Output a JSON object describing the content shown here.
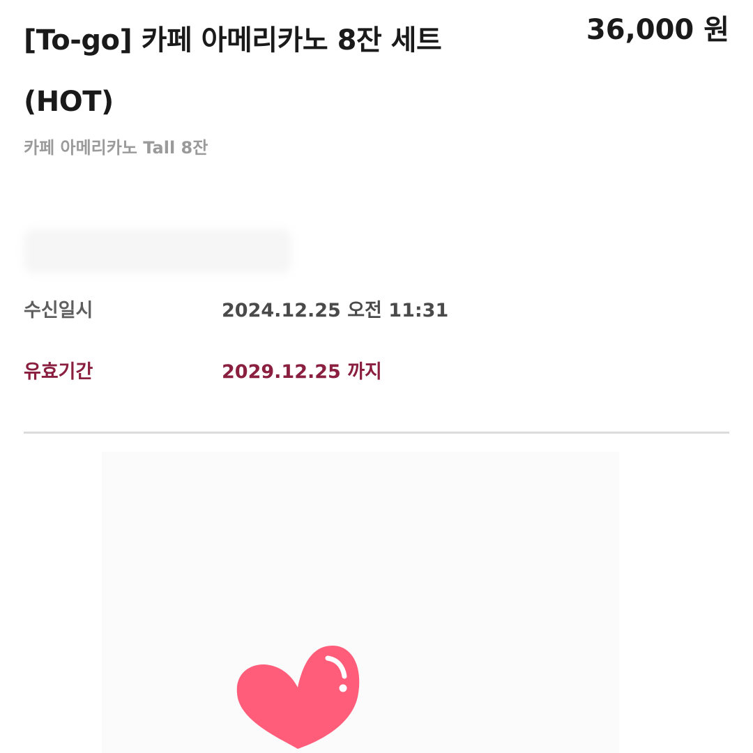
{
  "product": {
    "title": "[To-go] 카페 아메리카노 8잔 세트(HOT)",
    "price": "36,000 원",
    "subtitle": "카페 아메리카노 Tall 8잔"
  },
  "info": {
    "received_label": "수신일시",
    "received_value": "2024.12.25 오전 11:31",
    "validity_label": "유효기간",
    "validity_value": "2029.12.25 까지"
  },
  "colors": {
    "validity_accent": "#8a1f3f",
    "heart": "#ff5d7a"
  },
  "icons": {
    "heart": "heart-icon"
  }
}
